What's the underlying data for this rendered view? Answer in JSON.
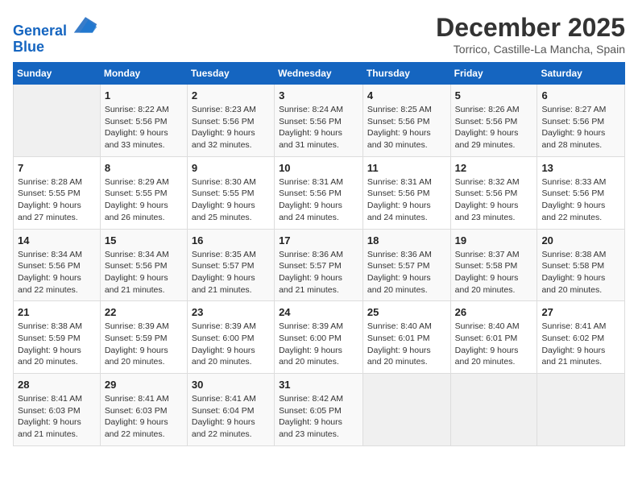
{
  "logo": {
    "line1": "General",
    "line2": "Blue"
  },
  "title": "December 2025",
  "location": "Torrico, Castille-La Mancha, Spain",
  "weekdays": [
    "Sunday",
    "Monday",
    "Tuesday",
    "Wednesday",
    "Thursday",
    "Friday",
    "Saturday"
  ],
  "weeks": [
    [
      {
        "day": "",
        "empty": true
      },
      {
        "day": "1",
        "sunrise": "8:22 AM",
        "sunset": "5:56 PM",
        "daylight": "9 hours and 33 minutes."
      },
      {
        "day": "2",
        "sunrise": "8:23 AM",
        "sunset": "5:56 PM",
        "daylight": "9 hours and 32 minutes."
      },
      {
        "day": "3",
        "sunrise": "8:24 AM",
        "sunset": "5:56 PM",
        "daylight": "9 hours and 31 minutes."
      },
      {
        "day": "4",
        "sunrise": "8:25 AM",
        "sunset": "5:56 PM",
        "daylight": "9 hours and 30 minutes."
      },
      {
        "day": "5",
        "sunrise": "8:26 AM",
        "sunset": "5:56 PM",
        "daylight": "9 hours and 29 minutes."
      },
      {
        "day": "6",
        "sunrise": "8:27 AM",
        "sunset": "5:56 PM",
        "daylight": "9 hours and 28 minutes."
      }
    ],
    [
      {
        "day": "7",
        "sunrise": "8:28 AM",
        "sunset": "5:55 PM",
        "daylight": "9 hours and 27 minutes."
      },
      {
        "day": "8",
        "sunrise": "8:29 AM",
        "sunset": "5:55 PM",
        "daylight": "9 hours and 26 minutes."
      },
      {
        "day": "9",
        "sunrise": "8:30 AM",
        "sunset": "5:55 PM",
        "daylight": "9 hours and 25 minutes."
      },
      {
        "day": "10",
        "sunrise": "8:31 AM",
        "sunset": "5:56 PM",
        "daylight": "9 hours and 24 minutes."
      },
      {
        "day": "11",
        "sunrise": "8:31 AM",
        "sunset": "5:56 PM",
        "daylight": "9 hours and 24 minutes."
      },
      {
        "day": "12",
        "sunrise": "8:32 AM",
        "sunset": "5:56 PM",
        "daylight": "9 hours and 23 minutes."
      },
      {
        "day": "13",
        "sunrise": "8:33 AM",
        "sunset": "5:56 PM",
        "daylight": "9 hours and 22 minutes."
      }
    ],
    [
      {
        "day": "14",
        "sunrise": "8:34 AM",
        "sunset": "5:56 PM",
        "daylight": "9 hours and 22 minutes."
      },
      {
        "day": "15",
        "sunrise": "8:34 AM",
        "sunset": "5:56 PM",
        "daylight": "9 hours and 21 minutes."
      },
      {
        "day": "16",
        "sunrise": "8:35 AM",
        "sunset": "5:57 PM",
        "daylight": "9 hours and 21 minutes."
      },
      {
        "day": "17",
        "sunrise": "8:36 AM",
        "sunset": "5:57 PM",
        "daylight": "9 hours and 21 minutes."
      },
      {
        "day": "18",
        "sunrise": "8:36 AM",
        "sunset": "5:57 PM",
        "daylight": "9 hours and 20 minutes."
      },
      {
        "day": "19",
        "sunrise": "8:37 AM",
        "sunset": "5:58 PM",
        "daylight": "9 hours and 20 minutes."
      },
      {
        "day": "20",
        "sunrise": "8:38 AM",
        "sunset": "5:58 PM",
        "daylight": "9 hours and 20 minutes."
      }
    ],
    [
      {
        "day": "21",
        "sunrise": "8:38 AM",
        "sunset": "5:59 PM",
        "daylight": "9 hours and 20 minutes."
      },
      {
        "day": "22",
        "sunrise": "8:39 AM",
        "sunset": "5:59 PM",
        "daylight": "9 hours and 20 minutes."
      },
      {
        "day": "23",
        "sunrise": "8:39 AM",
        "sunset": "6:00 PM",
        "daylight": "9 hours and 20 minutes."
      },
      {
        "day": "24",
        "sunrise": "8:39 AM",
        "sunset": "6:00 PM",
        "daylight": "9 hours and 20 minutes."
      },
      {
        "day": "25",
        "sunrise": "8:40 AM",
        "sunset": "6:01 PM",
        "daylight": "9 hours and 20 minutes."
      },
      {
        "day": "26",
        "sunrise": "8:40 AM",
        "sunset": "6:01 PM",
        "daylight": "9 hours and 20 minutes."
      },
      {
        "day": "27",
        "sunrise": "8:41 AM",
        "sunset": "6:02 PM",
        "daylight": "9 hours and 21 minutes."
      }
    ],
    [
      {
        "day": "28",
        "sunrise": "8:41 AM",
        "sunset": "6:03 PM",
        "daylight": "9 hours and 21 minutes."
      },
      {
        "day": "29",
        "sunrise": "8:41 AM",
        "sunset": "6:03 PM",
        "daylight": "9 hours and 22 minutes."
      },
      {
        "day": "30",
        "sunrise": "8:41 AM",
        "sunset": "6:04 PM",
        "daylight": "9 hours and 22 minutes."
      },
      {
        "day": "31",
        "sunrise": "8:42 AM",
        "sunset": "6:05 PM",
        "daylight": "9 hours and 23 minutes."
      },
      {
        "day": "",
        "empty": true
      },
      {
        "day": "",
        "empty": true
      },
      {
        "day": "",
        "empty": true
      }
    ]
  ]
}
